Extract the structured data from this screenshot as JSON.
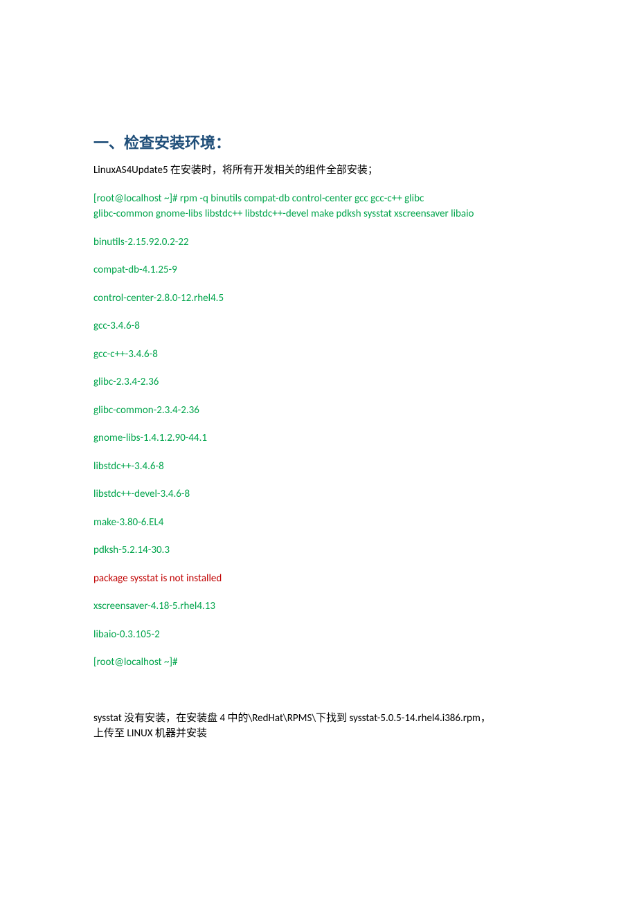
{
  "heading": "一、检查安装环境：",
  "intro": "LinuxAS4Update5 在安装时，将所有开发相关的组件全部安装；",
  "cmd_line_1": "[root@localhost ~]# rpm -q binutils compat-db control-center gcc gcc-c++ glibc",
  "cmd_line_2": "glibc-common gnome-libs libstdc++ libstdc++-devel make pdksh sysstat xscreensaver libaio",
  "pkg_binutils": "binutils-2.15.92.0.2-22",
  "pkg_compat_db": "compat-db-4.1.25-9",
  "pkg_control_center": "control-center-2.8.0-12.rhel4.5",
  "pkg_gcc": "gcc-3.4.6-8",
  "pkg_gcc_cpp": "gcc-c++-3.4.6-8",
  "pkg_glibc": "glibc-2.3.4-2.36",
  "pkg_glibc_common": "glibc-common-2.3.4-2.36",
  "pkg_gnome_libs": "gnome-libs-1.4.1.2.90-44.1",
  "pkg_libstdcpp": "libstdc++-3.4.6-8",
  "pkg_libstdcpp_devel": "libstdc++-devel-3.4.6-8",
  "pkg_make": "make-3.80-6.EL4",
  "pkg_pdksh": "pdksh-5.2.14-30.3",
  "pkg_sysstat_missing": "package sysstat is not installed",
  "pkg_xscreensaver": "xscreensaver-4.18-5.rhel4.13",
  "pkg_libaio": "libaio-0.3.105-2",
  "prompt": "[root@localhost ~]#",
  "note_line_1": "sysstat 没有安装，在安装盘 4 中的\\RedHat\\RPMS\\下找到 sysstat-5.0.5-14.rhel4.i386.rpm，",
  "note_line_2": "上传至 LINUX 机器并安装"
}
